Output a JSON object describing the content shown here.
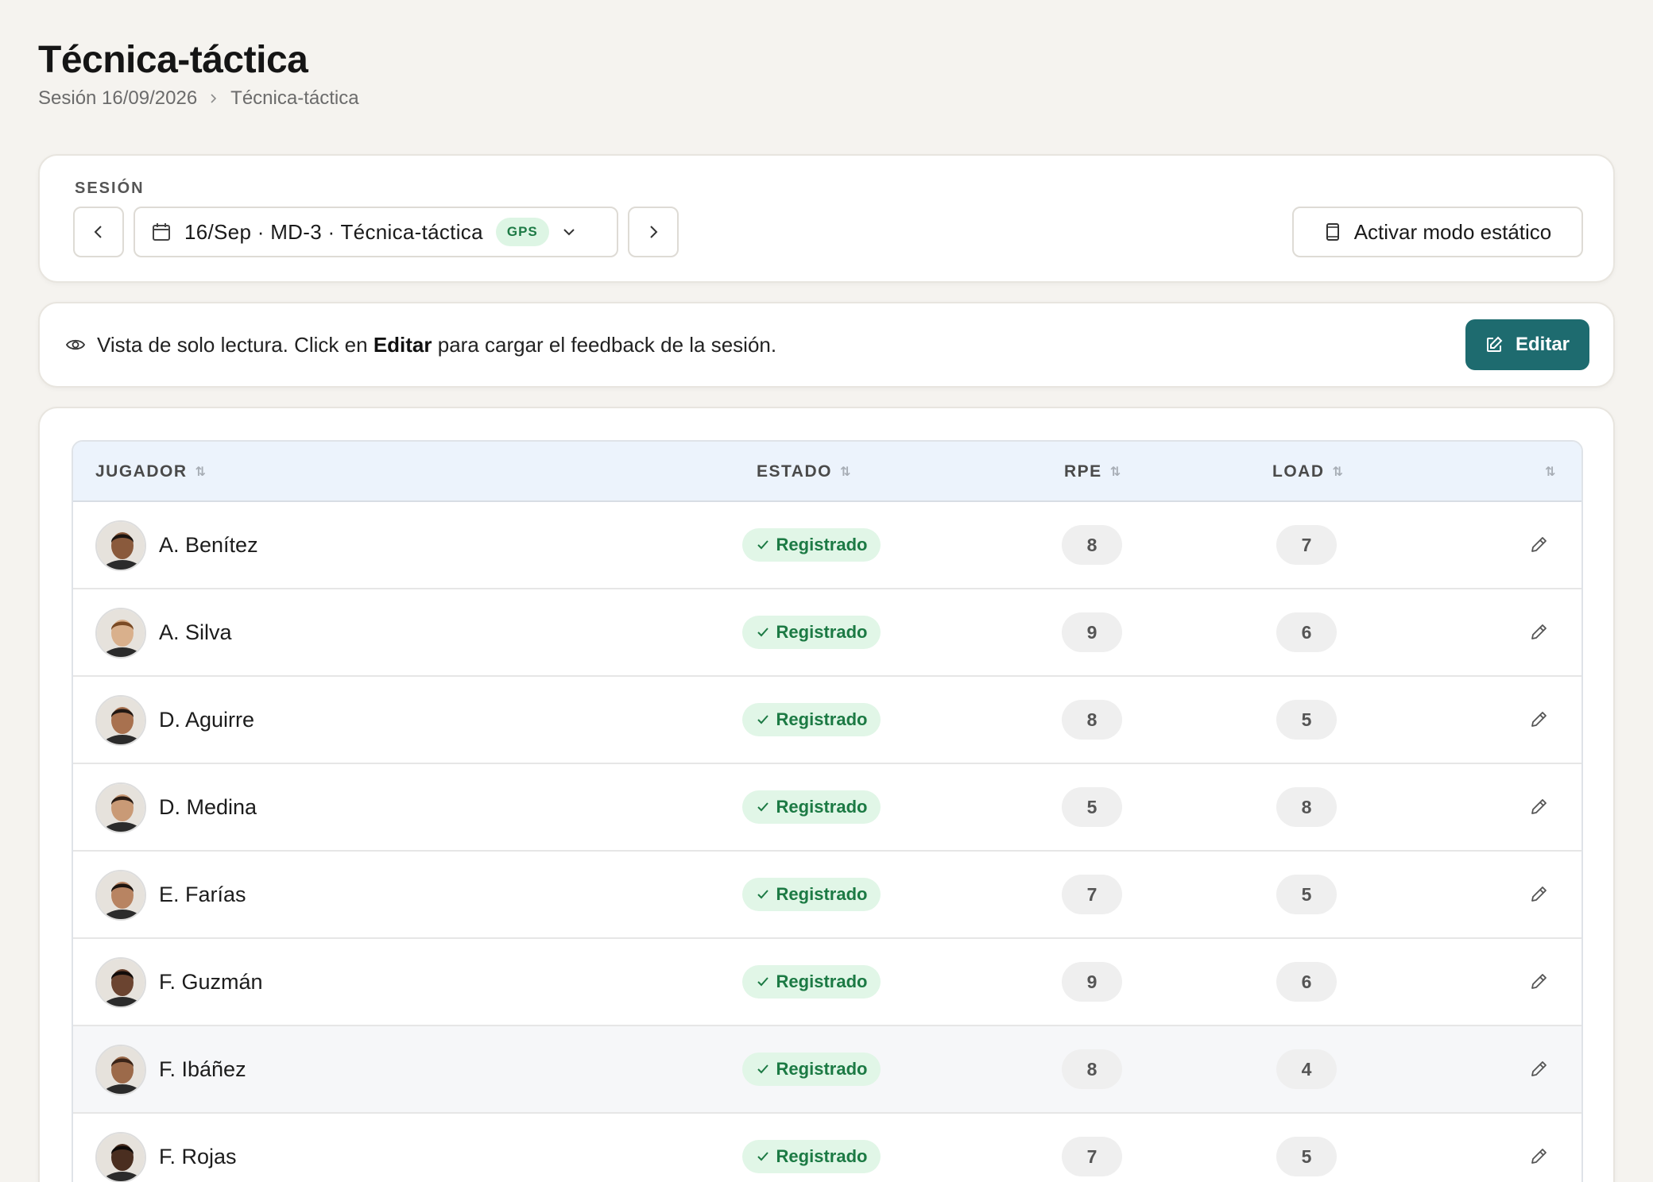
{
  "page": {
    "title": "Técnica-táctica",
    "breadcrumb": [
      "Sesión 16/09/2026",
      "Técnica-táctica"
    ]
  },
  "session": {
    "label": "SESIÓN",
    "selected": "16/Sep · MD-3 · Técnica-táctica",
    "badge": "GPS",
    "static_mode_label": "Activar modo estático"
  },
  "notice": {
    "text_before": "Vista de solo lectura. Click en",
    "text_bold": "Editar",
    "text_after": "para cargar el feedback de la sesión.",
    "edit_label": "Editar"
  },
  "table": {
    "columns": [
      "JUGADOR",
      "ESTADO",
      "RPE",
      "LOAD"
    ],
    "rows": [
      {
        "name": "A. Benítez",
        "status": "Registrado",
        "rpe": "8",
        "load": "7"
      },
      {
        "name": "A. Silva",
        "status": "Registrado",
        "rpe": "9",
        "load": "6"
      },
      {
        "name": "D. Aguirre",
        "status": "Registrado",
        "rpe": "8",
        "load": "5"
      },
      {
        "name": "D. Medina",
        "status": "Registrado",
        "rpe": "5",
        "load": "8"
      },
      {
        "name": "E. Farías",
        "status": "Registrado",
        "rpe": "7",
        "load": "5"
      },
      {
        "name": "F. Guzmán",
        "status": "Registrado",
        "rpe": "9",
        "load": "6"
      },
      {
        "name": "F. Ibáñez",
        "status": "Registrado",
        "rpe": "8",
        "load": "4"
      },
      {
        "name": "F. Rojas",
        "status": "Registrado",
        "rpe": "7",
        "load": "5"
      }
    ]
  },
  "colors": {
    "accent": "#1e6b6f",
    "status_bg": "#e1f6e7",
    "status_text": "#1c7a44",
    "header_bg": "#ecf3fc"
  }
}
